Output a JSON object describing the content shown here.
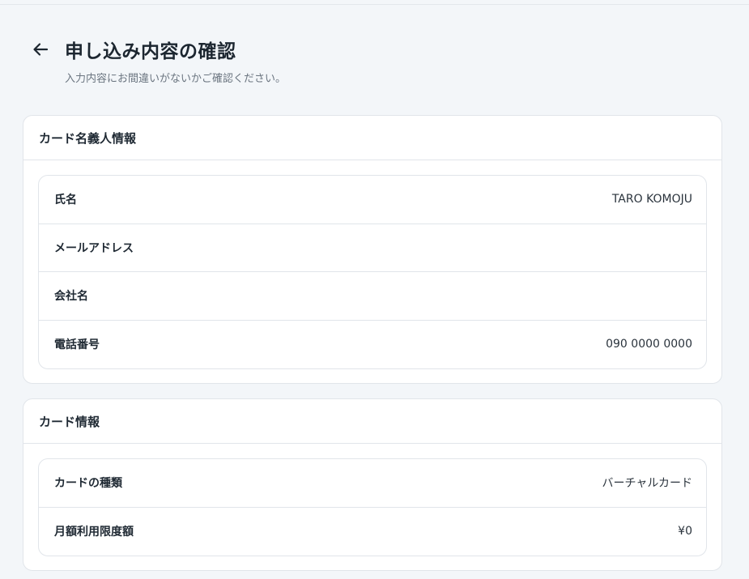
{
  "header": {
    "title": "申し込み内容の確認",
    "subtitle": "入力内容にお間違いがないかご確認ください。"
  },
  "cardholder_section": {
    "title": "カード名義人情報",
    "fields": [
      {
        "label": "氏名",
        "value": "TARO KOMOJU"
      },
      {
        "label": "メールアドレス",
        "value": ""
      },
      {
        "label": "会社名",
        "value": ""
      },
      {
        "label": "電話番号",
        "value": "090 0000 0000"
      }
    ]
  },
  "card_section": {
    "title": "カード情報",
    "fields": [
      {
        "label": "カードの種類",
        "value": "バーチャルカード"
      },
      {
        "label": "月額利用限度額",
        "value": "¥0"
      }
    ]
  },
  "icons": {
    "back": "arrow-left-icon"
  }
}
